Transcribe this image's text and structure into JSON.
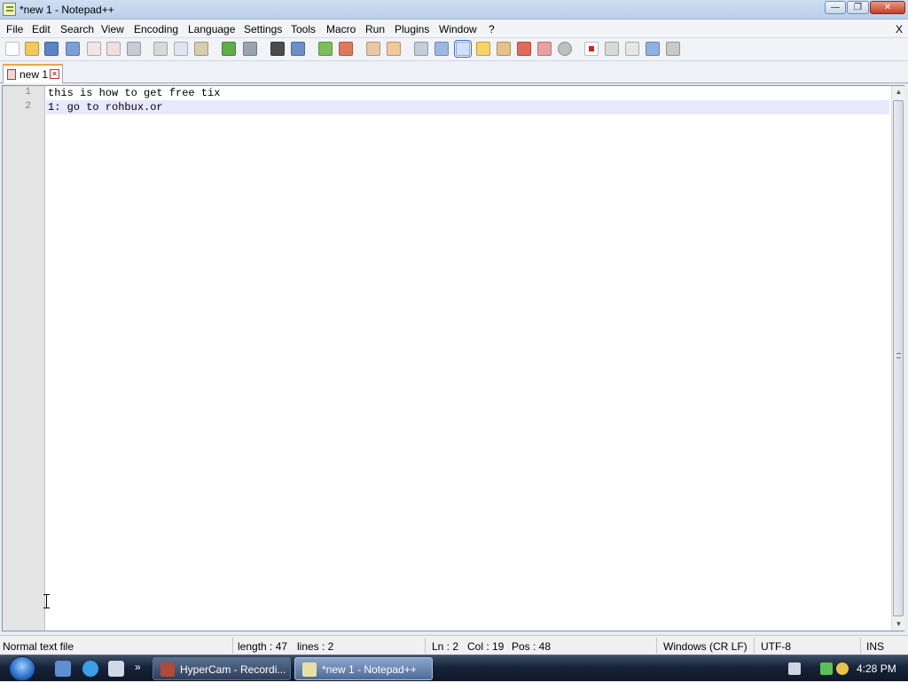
{
  "window": {
    "title": "*new 1 - Notepad++",
    "minimize_icon": "minimize-icon",
    "maximize_icon": "restore-icon",
    "close_icon": "close-icon"
  },
  "menu": {
    "items": [
      "File",
      "Edit",
      "Search",
      "View",
      "Encoding",
      "Language",
      "Settings",
      "Tools",
      "Macro",
      "Run",
      "Plugins",
      "Window",
      "?"
    ],
    "close_label": "X"
  },
  "toolbar": {
    "icons": [
      "new-file-icon",
      "open-file-icon",
      "save-icon",
      "save-all-icon",
      "close-icon",
      "close-all-icon",
      "print-icon",
      "cut-icon",
      "copy-icon",
      "paste-icon",
      "undo-icon",
      "redo-icon",
      "find-icon",
      "replace-icon",
      "zoom-in-icon",
      "zoom-out-icon",
      "sync-vertical-icon",
      "sync-horizontal-icon",
      "word-wrap-icon",
      "show-all-characters-icon",
      "indent-guide-icon",
      "user-defined-language-icon",
      "document-map-icon",
      "function-list-icon",
      "folder-as-workspace-icon",
      "monitoring-icon",
      "record-macro-icon",
      "stop-recording-icon",
      "playback-macro-icon",
      "run-macro-multiple-icon",
      "save-macro-icon"
    ],
    "selected": "indent-guide-icon"
  },
  "tabs": [
    {
      "label": "new 1",
      "icon": "unsaved-document-icon",
      "close_icon": "tab-close-icon"
    }
  ],
  "editor": {
    "lines": [
      {
        "number": "1",
        "text": "this is how to get free tix"
      },
      {
        "number": "2",
        "text": "1: go to rohbux.or"
      }
    ],
    "current_line": 2
  },
  "status": {
    "file_type": "Normal text file",
    "length": "length : 47",
    "lines": "lines : 2",
    "ln": "Ln : 2",
    "col": "Col : 19",
    "pos": "Pos : 48",
    "eol": "Windows (CR LF)",
    "encoding": "UTF-8",
    "mode": "INS"
  },
  "taskbar": {
    "start_icon": "windows-start-icon",
    "quick_launch": [
      "show-desktop-icon",
      "internet-explorer-icon",
      "email-icon"
    ],
    "more_icon": "chevron-right-icon",
    "buttons": [
      {
        "label": "HyperCam - Recordi...",
        "icon": "hypercam-icon",
        "active": false
      },
      {
        "label": "*new 1 - Notepad++",
        "icon": "notepad-plus-plus-icon",
        "active": true
      }
    ],
    "tray_icons": [
      "keyboard-icon",
      "network-icon",
      "volume-icon",
      "search-icon"
    ],
    "clock": "4:28 PM"
  },
  "colors": {
    "current_line_highlight": "#e8e8ff",
    "tab_accent": "#f2a33a",
    "taskbar_bg": "#17233a"
  }
}
